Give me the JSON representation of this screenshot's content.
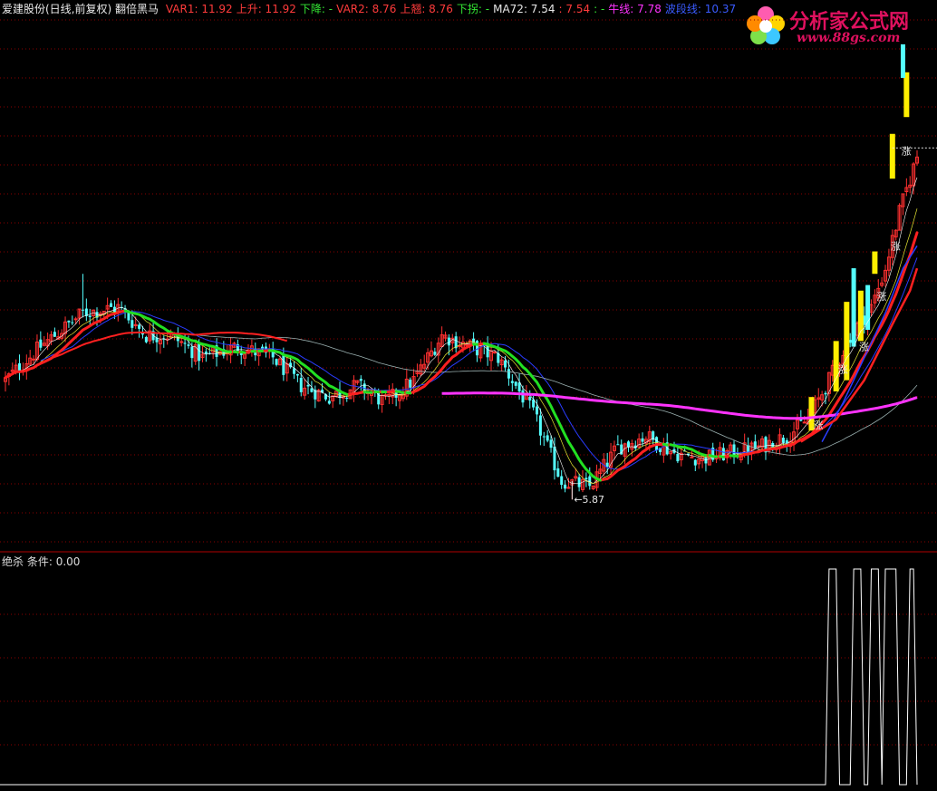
{
  "header": {
    "stock": "爱建股份(日线,前复权)",
    "formula": "翻倍黑马",
    "indicators": [
      {
        "label": "VAR1: ",
        "value": "11.92",
        "color": "#ff3b3b"
      },
      {
        "label": "上升: ",
        "value": "11.92",
        "color": "#ff3b3b"
      },
      {
        "label": "下降: ",
        "value": "-",
        "color": "#33e633"
      },
      {
        "label": "VAR2: ",
        "value": "8.76",
        "color": "#ff3b3b"
      },
      {
        "label": "上翘: ",
        "value": "8.76",
        "color": "#ff3b3b"
      },
      {
        "label": "下拐: ",
        "value": "-",
        "color": "#33e633"
      },
      {
        "label": "MA72: ",
        "value": "7.54",
        "color": "#e8e8e8"
      },
      {
        "label": ": ",
        "value": "7.54",
        "color": "#ff3b3b"
      },
      {
        "label": ": ",
        "value": "-",
        "color": "#33e633"
      },
      {
        "label": "牛线: ",
        "value": "7.78",
        "color": "#ff33ff"
      },
      {
        "label": "波段线: ",
        "value": "10.37",
        "color": "#3a5bff"
      }
    ]
  },
  "sub_header": {
    "name": "绝杀",
    "label": "条件: ",
    "value": "0.00"
  },
  "logo": {
    "text": "分析家公式网",
    "url_text": "www.88gs.com"
  },
  "chart_data": [
    {
      "type": "candlestick",
      "title": "翻倍黑马",
      "price_axis": [
        5.0,
        14.5
      ],
      "annotations": [
        {
          "text": "←5.87",
          "x": 161,
          "y": 5.87
        },
        {
          "text": "涨",
          "x": 229,
          "y": 7.2
        },
        {
          "text": "涨",
          "x": 236,
          "y": 8.2
        },
        {
          "text": "涨",
          "x": 242,
          "y": 8.6
        },
        {
          "text": "涨",
          "x": 247,
          "y": 9.5
        },
        {
          "text": "涨",
          "x": 251,
          "y": 10.4
        },
        {
          "text": "涨",
          "x": 254,
          "y": 12.1
        }
      ],
      "candles_generated_by": "seeded pseudo-random walk following the main lines"
    },
    {
      "type": "line",
      "title": "绝杀",
      "ylim": [
        0,
        1
      ],
      "pulses": [
        [
          234,
          236
        ],
        [
          241,
          243
        ],
        [
          246,
          248
        ],
        [
          250,
          253
        ],
        [
          257,
          258
        ]
      ],
      "n": 260
    }
  ]
}
